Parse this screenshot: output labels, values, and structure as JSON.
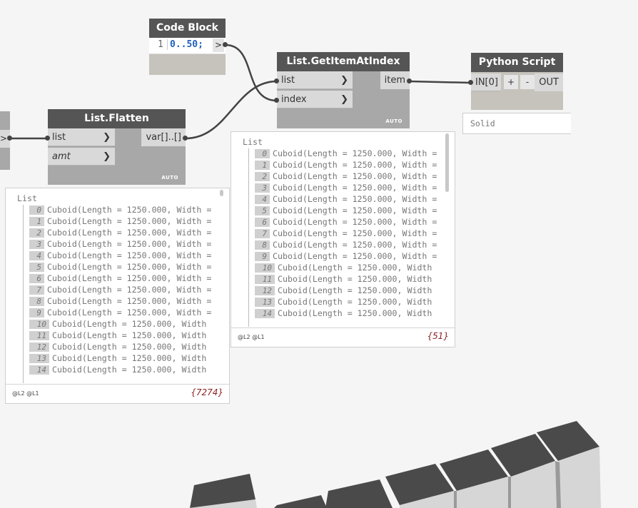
{
  "code_block": {
    "title": "Code Block",
    "line_number": "1",
    "code": "0..50;",
    "output_arrow": ">"
  },
  "flatten": {
    "title": "List.Flatten",
    "inputs": [
      "list",
      "amt"
    ],
    "output": "var[]..[]",
    "mode": "AUTO"
  },
  "get_item": {
    "title": "List.GetItemAtIndex",
    "inputs": [
      "list",
      "index"
    ],
    "output": "item",
    "mode": "AUTO"
  },
  "python": {
    "title": "Python Script",
    "input": "IN[0]",
    "add": "+",
    "remove": "-",
    "output": "OUT",
    "preview": "Solid"
  },
  "left_stub": {
    "arrow": ">"
  },
  "flatten_preview": {
    "list_label": "List",
    "rows": [
      {
        "i": "0",
        "t": "Cuboid(Length = 1250.000, Width ="
      },
      {
        "i": "1",
        "t": "Cuboid(Length = 1250.000, Width ="
      },
      {
        "i": "2",
        "t": "Cuboid(Length = 1250.000, Width ="
      },
      {
        "i": "3",
        "t": "Cuboid(Length = 1250.000, Width ="
      },
      {
        "i": "4",
        "t": "Cuboid(Length = 1250.000, Width ="
      },
      {
        "i": "5",
        "t": "Cuboid(Length = 1250.000, Width ="
      },
      {
        "i": "6",
        "t": "Cuboid(Length = 1250.000, Width ="
      },
      {
        "i": "7",
        "t": "Cuboid(Length = 1250.000, Width ="
      },
      {
        "i": "8",
        "t": "Cuboid(Length = 1250.000, Width ="
      },
      {
        "i": "9",
        "t": "Cuboid(Length = 1250.000, Width ="
      },
      {
        "i": "10",
        "t": "Cuboid(Length = 1250.000, Width"
      },
      {
        "i": "11",
        "t": "Cuboid(Length = 1250.000, Width"
      },
      {
        "i": "12",
        "t": "Cuboid(Length = 1250.000, Width"
      },
      {
        "i": "13",
        "t": "Cuboid(Length = 1250.000, Width"
      },
      {
        "i": "14",
        "t": "Cuboid(Length = 1250.000, Width"
      }
    ],
    "levels": "@L2 @L1",
    "count": "{7274}"
  },
  "getitem_preview": {
    "list_label": "List",
    "rows": [
      {
        "i": "0",
        "t": "Cuboid(Length = 1250.000, Width ="
      },
      {
        "i": "1",
        "t": "Cuboid(Length = 1250.000, Width ="
      },
      {
        "i": "2",
        "t": "Cuboid(Length = 1250.000, Width ="
      },
      {
        "i": "3",
        "t": "Cuboid(Length = 1250.000, Width ="
      },
      {
        "i": "4",
        "t": "Cuboid(Length = 1250.000, Width ="
      },
      {
        "i": "5",
        "t": "Cuboid(Length = 1250.000, Width ="
      },
      {
        "i": "6",
        "t": "Cuboid(Length = 1250.000, Width ="
      },
      {
        "i": "7",
        "t": "Cuboid(Length = 1250.000, Width ="
      },
      {
        "i": "8",
        "t": "Cuboid(Length = 1250.000, Width ="
      },
      {
        "i": "9",
        "t": "Cuboid(Length = 1250.000, Width ="
      },
      {
        "i": "10",
        "t": "Cuboid(Length = 1250.000, Width"
      },
      {
        "i": "11",
        "t": "Cuboid(Length = 1250.000, Width"
      },
      {
        "i": "12",
        "t": "Cuboid(Length = 1250.000, Width"
      },
      {
        "i": "13",
        "t": "Cuboid(Length = 1250.000, Width"
      },
      {
        "i": "14",
        "t": "Cuboid(Length = 1250.000, Width"
      }
    ],
    "levels": "@L2 @L1",
    "count": "{51}"
  },
  "colors": {
    "background": "#f5f5f5",
    "node_header": "#555555",
    "node_body": "#a8a8a8",
    "wire": "#444444",
    "code_number": "#1f5fbf",
    "count_text": "#8b1f1f",
    "cuboid_top": "#4a4a4a",
    "cuboid_side": "#d6d6d6"
  }
}
